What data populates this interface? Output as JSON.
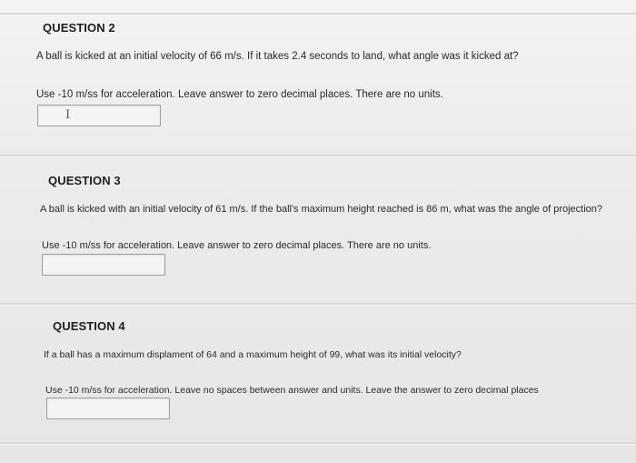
{
  "questions": [
    {
      "heading": "QUESTION 2",
      "text": "A ball is kicked at an initial velocity of 66 m/s. If it takes 2.4 seconds to land, what angle was it kicked at?",
      "instruction": "Use -10 m/ss for acceleration. Leave answer to zero decimal places. There are no units.",
      "answer_value": "",
      "cursor_icon": "text-cursor-icon"
    },
    {
      "heading": "QUESTION 3",
      "text": "A ball is kicked with an initial velocity of 61 m/s. If the ball's maximum height reached is 86 m, what was the angle of projection?",
      "instruction": "Use -10 m/ss for acceleration. Leave answer to zero decimal places. There are no units.",
      "answer_value": ""
    },
    {
      "heading": "QUESTION 4",
      "text": "If a ball has a maximum displament of 64 and a maximum height of 99, what was its initial velocity?",
      "instruction": "Use -10 m/ss for acceleration. Leave no spaces between answer and units. Leave the answer to zero decimal places",
      "answer_value": ""
    }
  ],
  "colors": {
    "background": "#ebebeb",
    "divider": "#d8d8d8",
    "input_border": "#9e9e9e",
    "text": "#222222"
  }
}
